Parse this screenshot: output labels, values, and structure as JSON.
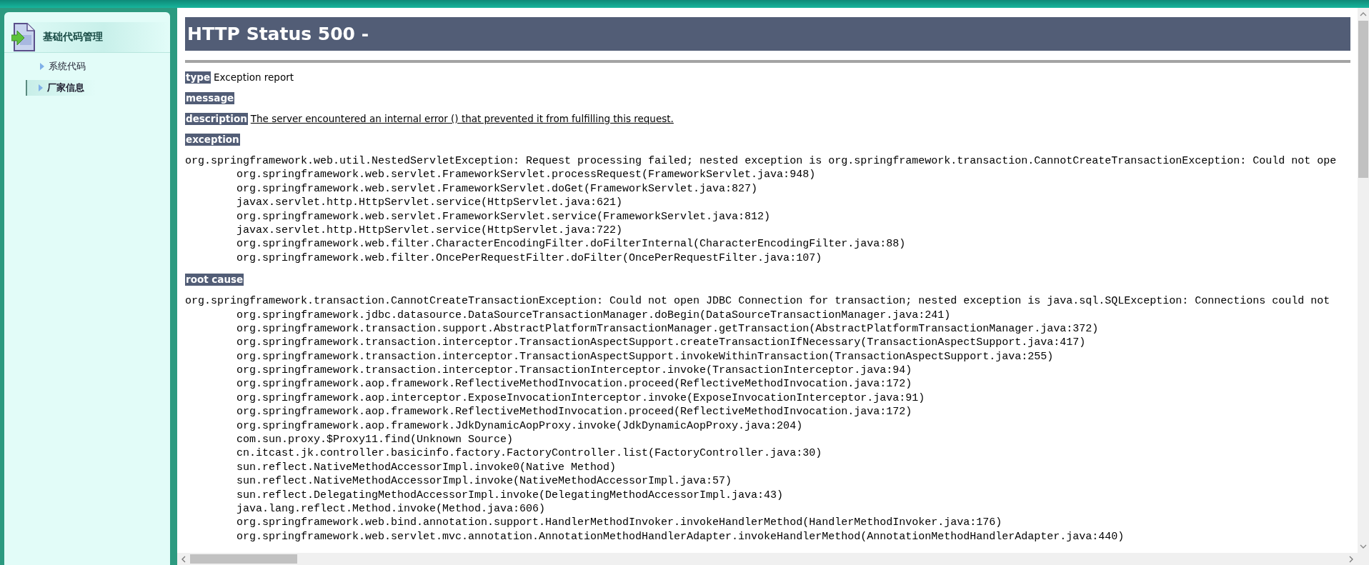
{
  "sidebar": {
    "section": "基础代码管理",
    "items": [
      {
        "label": "系统代码",
        "selected": false
      },
      {
        "label": "厂家信息",
        "selected": true
      }
    ]
  },
  "error_page": {
    "title": "HTTP Status 500 -",
    "sections": [
      {
        "label": "type",
        "text": "Exception report",
        "underlined": false
      },
      {
        "label": "message"
      },
      {
        "label": "description",
        "text": "The server encountered an internal error () that prevented it from fulfilling this request.",
        "underlined": true
      },
      {
        "label": "exception",
        "trace": {
          "head": "org.springframework.web.util.NestedServletException: Request processing failed; nested exception is org.springframework.transaction.CannotCreateTransactionException: Could not ope",
          "frames": [
            "org.springframework.web.servlet.FrameworkServlet.processRequest(FrameworkServlet.java:948)",
            "org.springframework.web.servlet.FrameworkServlet.doGet(FrameworkServlet.java:827)",
            "javax.servlet.http.HttpServlet.service(HttpServlet.java:621)",
            "org.springframework.web.servlet.FrameworkServlet.service(FrameworkServlet.java:812)",
            "javax.servlet.http.HttpServlet.service(HttpServlet.java:722)",
            "org.springframework.web.filter.CharacterEncodingFilter.doFilterInternal(CharacterEncodingFilter.java:88)",
            "org.springframework.web.filter.OncePerRequestFilter.doFilter(OncePerRequestFilter.java:107)"
          ]
        }
      },
      {
        "label": "root cause",
        "trace": {
          "head": "org.springframework.transaction.CannotCreateTransactionException: Could not open JDBC Connection for transaction; nested exception is java.sql.SQLException: Connections could not",
          "frames": [
            "org.springframework.jdbc.datasource.DataSourceTransactionManager.doBegin(DataSourceTransactionManager.java:241)",
            "org.springframework.transaction.support.AbstractPlatformTransactionManager.getTransaction(AbstractPlatformTransactionManager.java:372)",
            "org.springframework.transaction.interceptor.TransactionAspectSupport.createTransactionIfNecessary(TransactionAspectSupport.java:417)",
            "org.springframework.transaction.interceptor.TransactionAspectSupport.invokeWithinTransaction(TransactionAspectSupport.java:255)",
            "org.springframework.transaction.interceptor.TransactionInterceptor.invoke(TransactionInterceptor.java:94)",
            "org.springframework.aop.framework.ReflectiveMethodInvocation.proceed(ReflectiveMethodInvocation.java:172)",
            "org.springframework.aop.interceptor.ExposeInvocationInterceptor.invoke(ExposeInvocationInterceptor.java:91)",
            "org.springframework.aop.framework.ReflectiveMethodInvocation.proceed(ReflectiveMethodInvocation.java:172)",
            "org.springframework.aop.framework.JdkDynamicAopProxy.invoke(JdkDynamicAopProxy.java:204)",
            "com.sun.proxy.$Proxy11.find(Unknown Source)",
            "cn.itcast.jk.controller.basicinfo.factory.FactoryController.list(FactoryController.java:30)",
            "sun.reflect.NativeMethodAccessorImpl.invoke0(Native Method)",
            "sun.reflect.NativeMethodAccessorImpl.invoke(NativeMethodAccessorImpl.java:57)",
            "sun.reflect.DelegatingMethodAccessorImpl.invoke(DelegatingMethodAccessorImpl.java:43)",
            "java.lang.reflect.Method.invoke(Method.java:606)",
            "org.springframework.web.bind.annotation.support.HandlerMethodInvoker.invokeHandlerMethod(HandlerMethodInvoker.java:176)",
            "org.springframework.web.servlet.mvc.annotation.AnnotationMethodHandlerAdapter.invokeHandlerMethod(AnnotationMethodHandlerAdapter.java:440)"
          ]
        }
      }
    ]
  }
}
